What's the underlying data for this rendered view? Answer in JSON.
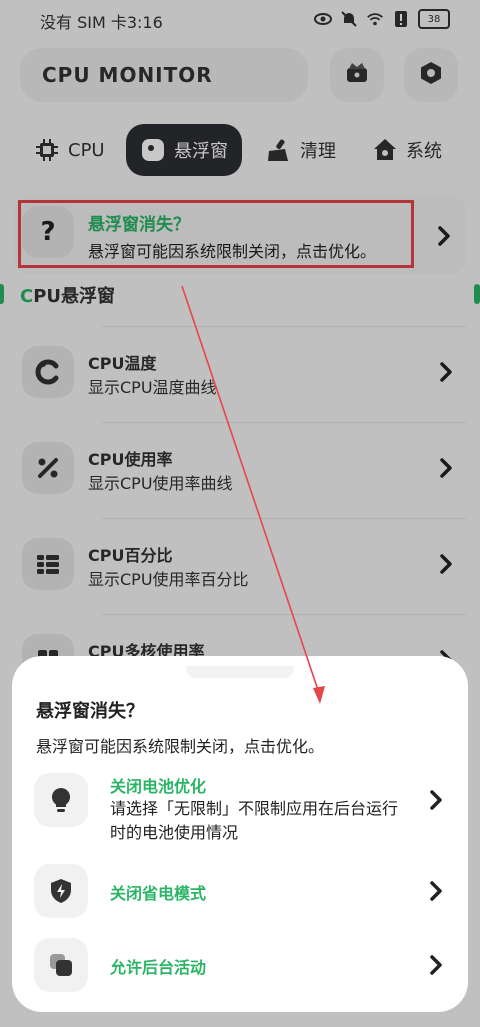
{
  "status": {
    "left": "没有 SIM 卡3:16",
    "battery": "38"
  },
  "header": {
    "title": "CPU MONITOR"
  },
  "tabs": [
    {
      "label": "CPU"
    },
    {
      "label": "悬浮窗"
    },
    {
      "label": "清理"
    },
    {
      "label": "系统"
    }
  ],
  "alert": {
    "title": "悬浮窗消失？",
    "subtitle": "悬浮窗可能因系统限制关闭，点击优化。"
  },
  "section": {
    "title_c": "C",
    "title_rest": "PU悬浮窗"
  },
  "list": [
    {
      "title": "CPU温度",
      "subtitle": "显示CPU温度曲线"
    },
    {
      "title": "CPU使用率",
      "subtitle": "显示CPU使用率曲线"
    },
    {
      "title": "CPU百分比",
      "subtitle": "显示CPU使用率百分比"
    },
    {
      "title": "CPU多核使用率",
      "subtitle": ""
    }
  ],
  "sheet": {
    "title": "悬浮窗消失？",
    "desc": "悬浮窗可能因系统限制关闭，点击优化。",
    "items": [
      {
        "title": "关闭电池优化",
        "desc": "请选择「无限制」不限制应用在后台运行时的电池使用情况"
      },
      {
        "title": "关闭省电模式",
        "desc": ""
      },
      {
        "title": "允许后台活动",
        "desc": ""
      }
    ]
  },
  "colors": {
    "accent_green": "#2bb466",
    "highlight_red": "#e6454a",
    "tab_active_bg": "#2d2f33"
  }
}
